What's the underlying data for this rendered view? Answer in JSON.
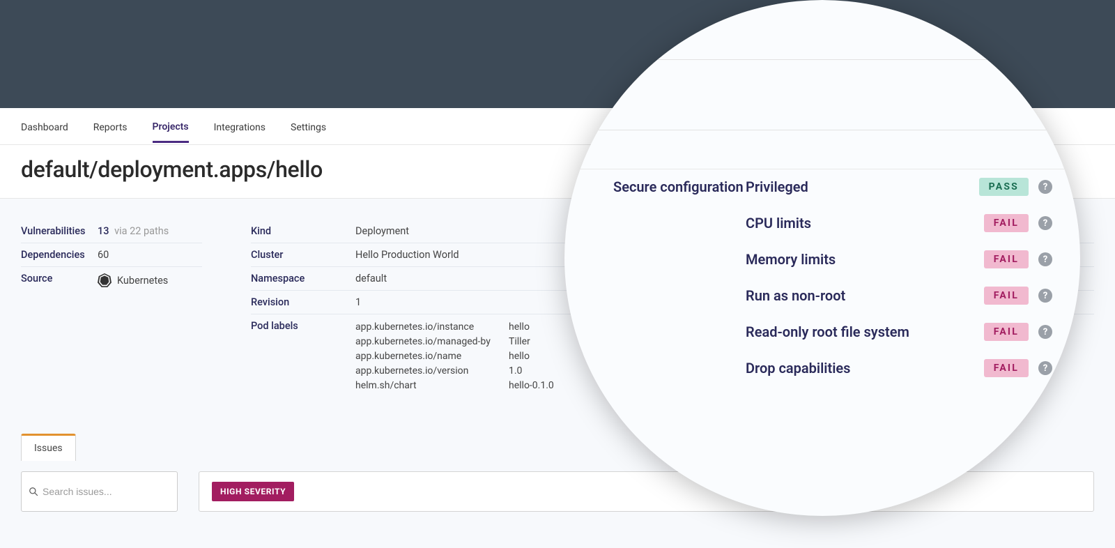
{
  "nav": {
    "items": [
      "Dashboard",
      "Reports",
      "Projects",
      "Integrations",
      "Settings"
    ],
    "active": "Projects"
  },
  "page_title": "default/deployment.apps/hello",
  "meta_left": {
    "vulnerabilities": {
      "label": "Vulnerabilities",
      "count": "13",
      "suffix": "via 22 paths"
    },
    "dependencies": {
      "label": "Dependencies",
      "value": "60"
    },
    "source": {
      "label": "Source",
      "value": "Kubernetes"
    }
  },
  "meta_right": {
    "kind": {
      "label": "Kind",
      "value": "Deployment"
    },
    "cluster": {
      "label": "Cluster",
      "value": "Hello Production World"
    },
    "namespace": {
      "label": "Namespace",
      "value": "default"
    },
    "revision": {
      "label": "Revision",
      "value": "1"
    },
    "pod_labels": {
      "label": "Pod labels",
      "items": [
        {
          "k": "app.kubernetes.io/instance",
          "v": "hello"
        },
        {
          "k": "app.kubernetes.io/managed-by",
          "v": "Tiller"
        },
        {
          "k": "app.kubernetes.io/name",
          "v": "hello"
        },
        {
          "k": "app.kubernetes.io/version",
          "v": "1.0"
        },
        {
          "k": "helm.sh/chart",
          "v": "hello-0.1.0"
        }
      ]
    }
  },
  "tabs": {
    "issues": "Issues"
  },
  "search": {
    "placeholder": "Search issues..."
  },
  "severity_badge": "HIGH SEVERITY",
  "secure_config": {
    "title": "Secure configuration",
    "pass_label": "PASS",
    "fail_label": "FAIL",
    "rows": [
      {
        "label": "Privileged",
        "status": "pass"
      },
      {
        "label": "CPU limits",
        "status": "fail"
      },
      {
        "label": "Memory limits",
        "status": "fail"
      },
      {
        "label": "Run as non-root",
        "status": "fail"
      },
      {
        "label": "Read-only root file system",
        "status": "fail"
      },
      {
        "label": "Drop capabilities",
        "status": "fail"
      }
    ]
  }
}
